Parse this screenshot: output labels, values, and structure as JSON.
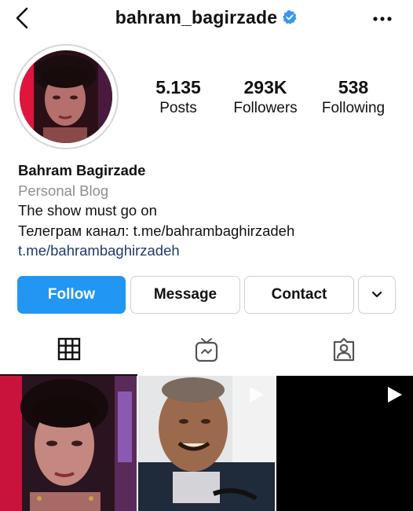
{
  "header": {
    "username": "bahram_bagirzade",
    "back_icon": "chevron-left-icon",
    "verified_icon": "verified-badge-icon",
    "more_icon": "more-horizontal-icon"
  },
  "profile": {
    "stats": [
      {
        "value": "5.135",
        "label": "Posts"
      },
      {
        "value": "293K",
        "label": "Followers"
      },
      {
        "value": "538",
        "label": "Following"
      }
    ]
  },
  "bio": {
    "name": "Bahram Bagirzade",
    "category": "Personal Blog",
    "lines": [
      "The show must go on",
      "Телеграм канал: t.me/bahrambaghirzadeh"
    ],
    "link": "t.me/bahrambaghirzadeh"
  },
  "actions": {
    "follow": "Follow",
    "message": "Message",
    "contact": "Contact",
    "more_icon": "chevron-down-icon"
  },
  "tabs": [
    {
      "icon": "grid-icon",
      "active": true
    },
    {
      "icon": "igtv-icon",
      "active": false
    },
    {
      "icon": "tagged-icon",
      "active": false
    }
  ],
  "posts": [
    {
      "type": "photo"
    },
    {
      "type": "video"
    },
    {
      "type": "video"
    }
  ],
  "colors": {
    "accent": "#2196f3",
    "verified": "#3897f0",
    "link": "#1f3b6b",
    "muted": "#8e8e8e"
  }
}
